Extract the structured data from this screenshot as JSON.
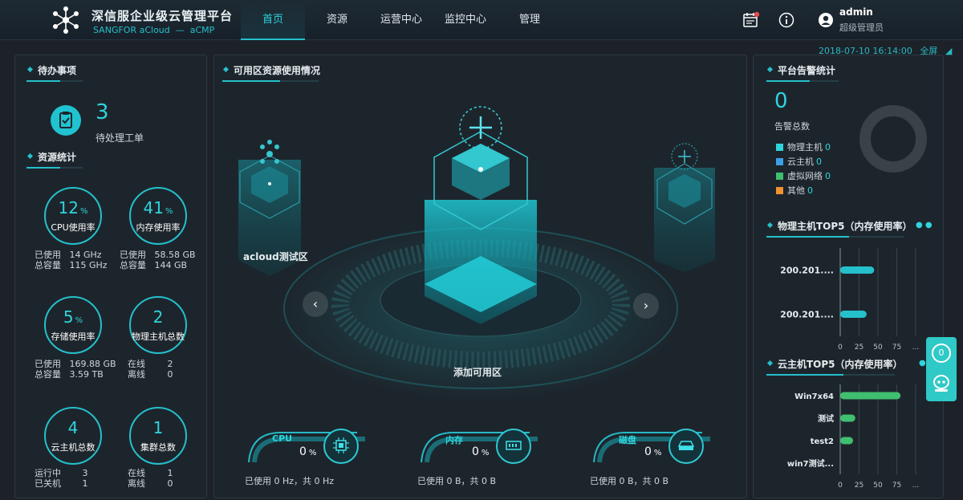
{
  "header": {
    "title": "深信服企业级云管理平台",
    "subtitle": "SANGFOR aCloud  —  aCMP",
    "nav": [
      {
        "label": "首页",
        "active": true
      },
      {
        "label": "资源",
        "active": false
      },
      {
        "label": "运营中心",
        "active": false
      },
      {
        "label": "监控中心",
        "active": false
      },
      {
        "label": "管理",
        "active": false
      }
    ],
    "user": {
      "name": "admin",
      "role": "超级管理员"
    }
  },
  "topbar": {
    "datetime": "2018-07-10 16:14:00",
    "fullscreen_label": "全屏"
  },
  "left": {
    "todo": {
      "title": "待办事项",
      "count": "3",
      "label": "待处理工单"
    },
    "resources": {
      "title": "资源统计",
      "cpu": {
        "value": "12",
        "unit": "%",
        "label": "CPU使用率",
        "used_key": "已使用",
        "used": "14 GHz",
        "total_key": "总容量",
        "total": "115 GHz"
      },
      "mem": {
        "value": "41",
        "unit": "%",
        "label": "内存使用率",
        "used_key": "已使用",
        "used": "58.58 GB",
        "total_key": "总容量",
        "total": "144 GB"
      },
      "storage": {
        "value": "5",
        "unit": "%",
        "label": "存储使用率",
        "used_key": "已使用",
        "used": "169.88 GB",
        "total_key": "总容量",
        "total": "3.59 TB"
      },
      "hosts": {
        "value": "2",
        "label": "物理主机总数",
        "online_key": "在线",
        "online": "2",
        "offline_key": "离线",
        "offline": "0"
      },
      "vms": {
        "value": "4",
        "label": "云主机总数",
        "running_key": "运行中",
        "running": "3",
        "stopped_key": "已关机",
        "stopped": "1"
      },
      "clusters": {
        "value": "1",
        "label": "集群总数",
        "online_key": "在线",
        "online": "1",
        "offline_key": "离线",
        "offline": "0"
      }
    }
  },
  "middle": {
    "title": "可用区资源使用情况",
    "zone_left": "acloud测试区",
    "zone_center": "添加可用区",
    "gauges": [
      {
        "name": "CPU",
        "value": "0",
        "unit": "%",
        "used": "已使用 0 Hz，共 0 Hz"
      },
      {
        "name": "内存",
        "value": "0",
        "unit": "%",
        "used": "已使用 0 B，共 0 B"
      },
      {
        "name": "磁盘",
        "value": "0",
        "unit": "%",
        "used": "已使用 0 B，共 0 B"
      }
    ]
  },
  "right": {
    "alarm": {
      "title": "平台告警统计",
      "total": "0",
      "label": "告警总数",
      "legend": [
        {
          "name": "物理主机",
          "count": "0",
          "color": "#2fd4dd"
        },
        {
          "name": "云主机",
          "count": "0",
          "color": "#3aa0e8"
        },
        {
          "name": "虚拟网络",
          "count": "0",
          "color": "#3fbf6f"
        },
        {
          "name": "其他",
          "count": "0",
          "color": "#f0922e"
        }
      ]
    },
    "host_top5": {
      "title": "物理主机TOP5（内存使用率）",
      "chart_data": {
        "type": "bar",
        "orientation": "horizontal",
        "categories": [
          "200.201....",
          "200.201...."
        ],
        "values": [
          45,
          35
        ],
        "xticks": [
          "0",
          "25",
          "50",
          "75",
          "..."
        ],
        "xlim": [
          0,
          100
        ],
        "color": "#24c0cc"
      }
    },
    "vm_top5": {
      "title": "云主机TOP5（内存使用率）",
      "chart_data": {
        "type": "bar",
        "orientation": "horizontal",
        "categories": [
          "Win7x64",
          "测试",
          "test2",
          "win7测试..."
        ],
        "values": [
          80,
          20,
          17,
          0
        ],
        "xticks": [
          "0",
          "25",
          "50",
          "75",
          "..."
        ],
        "xlim": [
          0,
          100
        ],
        "color": "#3fbf6f"
      }
    },
    "side_widget_count": "0"
  }
}
